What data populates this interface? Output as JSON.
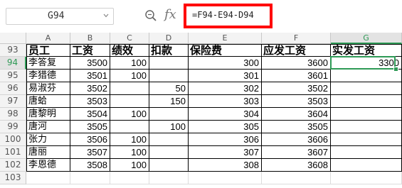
{
  "name_box": {
    "value": "G94"
  },
  "formula": {
    "text": "=F94-E94-D94"
  },
  "icons": {
    "dropdown": "chevron-down-icon",
    "zoom": "zoom-icon",
    "fx": "fx-icon",
    "fx_label": "fx"
  },
  "colors": {
    "highlight_border": "#ff0000",
    "selection": "#2e9a56"
  },
  "columns": [
    "A",
    "B",
    "C",
    "D",
    "E",
    "F",
    "G"
  ],
  "selected_column": "G",
  "selected_row": "94",
  "rows": [
    {
      "num": "93",
      "cells": [
        "员工",
        "工资",
        "绩效",
        "扣款",
        "保险费",
        "应发工资",
        "实发工资"
      ]
    },
    {
      "num": "94",
      "cells": [
        "李答复",
        "3500",
        "100",
        "",
        "300",
        "3600",
        "3300"
      ]
    },
    {
      "num": "95",
      "cells": [
        "李猎德",
        "3501",
        "100",
        "",
        "301",
        "3601",
        ""
      ]
    },
    {
      "num": "96",
      "cells": [
        "易淑芬",
        "3502",
        "",
        "50",
        "302",
        "3502",
        ""
      ]
    },
    {
      "num": "97",
      "cells": [
        "唐蛤",
        "3503",
        "",
        "150",
        "303",
        "3503",
        ""
      ]
    },
    {
      "num": "98",
      "cells": [
        "唐黎明",
        "3504",
        "100",
        "",
        "304",
        "3604",
        ""
      ]
    },
    {
      "num": "99",
      "cells": [
        "唐河",
        "3505",
        "",
        "100",
        "305",
        "3505",
        ""
      ]
    },
    {
      "num": "100",
      "cells": [
        "张力",
        "3506",
        "100",
        "",
        "306",
        "3606",
        ""
      ]
    },
    {
      "num": "101",
      "cells": [
        "唐丽",
        "3507",
        "100",
        "",
        "307",
        "3607",
        ""
      ]
    },
    {
      "num": "102",
      "cells": [
        "李恩德",
        "3508",
        "100",
        "",
        "308",
        "3608",
        ""
      ]
    },
    {
      "num": "103",
      "cells": [
        "",
        "",
        "",
        "",
        "",
        "",
        ""
      ]
    }
  ]
}
